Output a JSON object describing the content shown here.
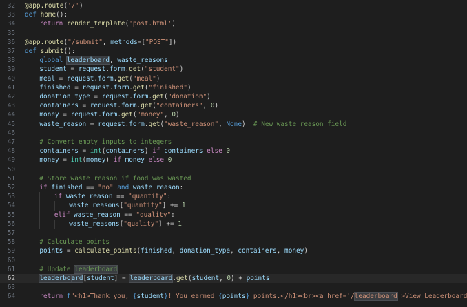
{
  "lines": [
    {
      "n": "32",
      "tokens": [
        [
          "t-fn",
          "@app.route"
        ],
        [
          "t-op",
          "("
        ],
        [
          "t-str",
          "'/'"
        ],
        [
          "t-op",
          ")"
        ]
      ]
    },
    {
      "n": "33",
      "tokens": [
        [
          "t-def",
          "def "
        ],
        [
          "t-fn",
          "home"
        ],
        [
          "t-op",
          "():"
        ]
      ]
    },
    {
      "n": "34",
      "indent": 1,
      "tokens": [
        [
          "t-kw",
          "return "
        ],
        [
          "t-fn",
          "render_template"
        ],
        [
          "t-op",
          "("
        ],
        [
          "t-str",
          "'post.html'"
        ],
        [
          "t-op",
          ")"
        ]
      ]
    },
    {
      "n": "35",
      "tokens": []
    },
    {
      "n": "36",
      "tokens": [
        [
          "t-fn",
          "@app.route"
        ],
        [
          "t-op",
          "("
        ],
        [
          "t-str",
          "\"/submit\""
        ],
        [
          "t-op",
          ", "
        ],
        [
          "t-var",
          "methods"
        ],
        [
          "t-op",
          "=["
        ],
        [
          "t-str",
          "\"POST\""
        ],
        [
          "t-op",
          "])"
        ]
      ]
    },
    {
      "n": "37",
      "tokens": [
        [
          "t-def",
          "def "
        ],
        [
          "t-fn",
          "submit"
        ],
        [
          "t-op",
          "():"
        ]
      ]
    },
    {
      "n": "38",
      "indent": 1,
      "tokens": [
        [
          "t-def",
          "global "
        ],
        [
          "hl t-var",
          "leaderboard"
        ],
        [
          "t-op",
          ", "
        ],
        [
          "t-var",
          "waste_reasons"
        ]
      ]
    },
    {
      "n": "39",
      "indent": 1,
      "tokens": [
        [
          "t-var",
          "student"
        ],
        [
          "t-op",
          " = "
        ],
        [
          "t-var",
          "request"
        ],
        [
          "t-op",
          "."
        ],
        [
          "t-var",
          "form"
        ],
        [
          "t-op",
          "."
        ],
        [
          "t-fn",
          "get"
        ],
        [
          "t-op",
          "("
        ],
        [
          "t-str",
          "\"student\""
        ],
        [
          "t-op",
          ")"
        ]
      ]
    },
    {
      "n": "40",
      "indent": 1,
      "tokens": [
        [
          "t-var",
          "meal"
        ],
        [
          "t-op",
          " = "
        ],
        [
          "t-var",
          "request"
        ],
        [
          "t-op",
          "."
        ],
        [
          "t-var",
          "form"
        ],
        [
          "t-op",
          "."
        ],
        [
          "t-fn",
          "get"
        ],
        [
          "t-op",
          "("
        ],
        [
          "t-str",
          "\"meal\""
        ],
        [
          "t-op",
          ")"
        ]
      ]
    },
    {
      "n": "41",
      "indent": 1,
      "tokens": [
        [
          "t-var",
          "finished"
        ],
        [
          "t-op",
          " = "
        ],
        [
          "t-var",
          "request"
        ],
        [
          "t-op",
          "."
        ],
        [
          "t-var",
          "form"
        ],
        [
          "t-op",
          "."
        ],
        [
          "t-fn",
          "get"
        ],
        [
          "t-op",
          "("
        ],
        [
          "t-str",
          "\"finished\""
        ],
        [
          "t-op",
          ")"
        ]
      ]
    },
    {
      "n": "42",
      "indent": 1,
      "tokens": [
        [
          "t-var",
          "donation_type"
        ],
        [
          "t-op",
          " = "
        ],
        [
          "t-var",
          "request"
        ],
        [
          "t-op",
          "."
        ],
        [
          "t-var",
          "form"
        ],
        [
          "t-op",
          "."
        ],
        [
          "t-fn",
          "get"
        ],
        [
          "t-op",
          "("
        ],
        [
          "t-str",
          "\"donation\""
        ],
        [
          "t-op",
          ")"
        ]
      ]
    },
    {
      "n": "43",
      "indent": 1,
      "tokens": [
        [
          "t-var",
          "containers"
        ],
        [
          "t-op",
          " = "
        ],
        [
          "t-var",
          "request"
        ],
        [
          "t-op",
          "."
        ],
        [
          "t-var",
          "form"
        ],
        [
          "t-op",
          "."
        ],
        [
          "t-fn",
          "get"
        ],
        [
          "t-op",
          "("
        ],
        [
          "t-str",
          "\"containers\""
        ],
        [
          "t-op",
          ", "
        ],
        [
          "t-num",
          "0"
        ],
        [
          "t-op",
          ")"
        ]
      ]
    },
    {
      "n": "44",
      "indent": 1,
      "tokens": [
        [
          "t-var",
          "money"
        ],
        [
          "t-op",
          " = "
        ],
        [
          "t-var",
          "request"
        ],
        [
          "t-op",
          "."
        ],
        [
          "t-var",
          "form"
        ],
        [
          "t-op",
          "."
        ],
        [
          "t-fn",
          "get"
        ],
        [
          "t-op",
          "("
        ],
        [
          "t-str",
          "\"money\""
        ],
        [
          "t-op",
          ", "
        ],
        [
          "t-num",
          "0"
        ],
        [
          "t-op",
          ")"
        ]
      ]
    },
    {
      "n": "45",
      "indent": 1,
      "tokens": [
        [
          "t-var",
          "waste_reason"
        ],
        [
          "t-op",
          " = "
        ],
        [
          "t-var",
          "request"
        ],
        [
          "t-op",
          "."
        ],
        [
          "t-var",
          "form"
        ],
        [
          "t-op",
          "."
        ],
        [
          "t-fn",
          "get"
        ],
        [
          "t-op",
          "("
        ],
        [
          "t-str",
          "\"waste_reason\""
        ],
        [
          "t-op",
          ", "
        ],
        [
          "t-const",
          "None"
        ],
        [
          "t-op",
          ")  "
        ],
        [
          "t-com",
          "# New waste reason field"
        ]
      ]
    },
    {
      "n": "46",
      "indent": 1,
      "tokens": []
    },
    {
      "n": "47",
      "indent": 1,
      "tokens": [
        [
          "t-com",
          "# Convert empty inputs to integers"
        ]
      ]
    },
    {
      "n": "48",
      "indent": 1,
      "tokens": [
        [
          "t-var",
          "containers"
        ],
        [
          "t-op",
          " = "
        ],
        [
          "t-builtin",
          "int"
        ],
        [
          "t-op",
          "("
        ],
        [
          "t-var",
          "containers"
        ],
        [
          "t-op",
          ") "
        ],
        [
          "t-kw",
          "if "
        ],
        [
          "t-var",
          "containers"
        ],
        [
          "t-kw",
          " else "
        ],
        [
          "t-num",
          "0"
        ]
      ]
    },
    {
      "n": "49",
      "indent": 1,
      "tokens": [
        [
          "t-var",
          "money"
        ],
        [
          "t-op",
          " = "
        ],
        [
          "t-builtin",
          "int"
        ],
        [
          "t-op",
          "("
        ],
        [
          "t-var",
          "money"
        ],
        [
          "t-op",
          ") "
        ],
        [
          "t-kw",
          "if "
        ],
        [
          "t-var",
          "money"
        ],
        [
          "t-kw",
          " else "
        ],
        [
          "t-num",
          "0"
        ]
      ]
    },
    {
      "n": "50",
      "indent": 1,
      "tokens": []
    },
    {
      "n": "51",
      "indent": 1,
      "tokens": [
        [
          "t-com",
          "# Store waste reason if food was wasted"
        ]
      ]
    },
    {
      "n": "52",
      "indent": 1,
      "tokens": [
        [
          "t-kw",
          "if "
        ],
        [
          "t-var",
          "finished"
        ],
        [
          "t-op",
          " == "
        ],
        [
          "t-str",
          "\"no\""
        ],
        [
          "t-def",
          " and "
        ],
        [
          "t-var",
          "waste_reason"
        ],
        [
          "t-op",
          ":"
        ]
      ]
    },
    {
      "n": "53",
      "indent": 2,
      "tokens": [
        [
          "t-kw",
          "if "
        ],
        [
          "t-var",
          "waste_reason"
        ],
        [
          "t-op",
          " == "
        ],
        [
          "t-str",
          "\"quantity\""
        ],
        [
          "t-op",
          ":"
        ]
      ]
    },
    {
      "n": "54",
      "indent": 3,
      "tokens": [
        [
          "t-var",
          "waste_reasons"
        ],
        [
          "t-op",
          "["
        ],
        [
          "t-str",
          "\"quantity\""
        ],
        [
          "t-op",
          "] += "
        ],
        [
          "t-num",
          "1"
        ]
      ]
    },
    {
      "n": "55",
      "indent": 2,
      "tokens": [
        [
          "t-kw",
          "elif "
        ],
        [
          "t-var",
          "waste_reason"
        ],
        [
          "t-op",
          " == "
        ],
        [
          "t-str",
          "\"quality\""
        ],
        [
          "t-op",
          ":"
        ]
      ]
    },
    {
      "n": "56",
      "indent": 3,
      "tokens": [
        [
          "t-var",
          "waste_reasons"
        ],
        [
          "t-op",
          "["
        ],
        [
          "t-str",
          "\"quality\""
        ],
        [
          "t-op",
          "] += "
        ],
        [
          "t-num",
          "1"
        ]
      ]
    },
    {
      "n": "57",
      "indent": 1,
      "tokens": []
    },
    {
      "n": "58",
      "indent": 1,
      "tokens": [
        [
          "t-com",
          "# Calculate points"
        ]
      ]
    },
    {
      "n": "59",
      "indent": 1,
      "tokens": [
        [
          "t-var",
          "points"
        ],
        [
          "t-op",
          " = "
        ],
        [
          "t-fn",
          "calculate_points"
        ],
        [
          "t-op",
          "("
        ],
        [
          "t-var",
          "finished"
        ],
        [
          "t-op",
          ", "
        ],
        [
          "t-var",
          "donation_type"
        ],
        [
          "t-op",
          ", "
        ],
        [
          "t-var",
          "containers"
        ],
        [
          "t-op",
          ", "
        ],
        [
          "t-var",
          "money"
        ],
        [
          "t-op",
          ")"
        ]
      ]
    },
    {
      "n": "60",
      "indent": 1,
      "tokens": []
    },
    {
      "n": "61",
      "indent": 1,
      "tokens": [
        [
          "t-com",
          "# Update "
        ],
        [
          "hl t-com",
          "leaderboard"
        ]
      ]
    },
    {
      "n": "62",
      "indent": 1,
      "current": true,
      "tokens": [
        [
          "hl t-var",
          "leaderbo"
        ],
        [
          "cursor",
          ""
        ],
        [
          "hl t-var",
          "ard"
        ],
        [
          "t-op",
          "["
        ],
        [
          "t-var",
          "student"
        ],
        [
          "t-op",
          "] = "
        ],
        [
          "hl t-var",
          "leaderboard"
        ],
        [
          "t-op",
          "."
        ],
        [
          "t-fn",
          "get"
        ],
        [
          "t-op",
          "("
        ],
        [
          "t-var",
          "student"
        ],
        [
          "t-op",
          ", "
        ],
        [
          "t-num",
          "0"
        ],
        [
          "t-op",
          ") + "
        ],
        [
          "t-var",
          "points"
        ]
      ]
    },
    {
      "n": "63",
      "indent": 1,
      "tokens": []
    },
    {
      "n": "64",
      "indent": 1,
      "tokens": [
        [
          "t-kw",
          "return "
        ],
        [
          "t-def",
          "f"
        ],
        [
          "t-str",
          "\"<h1>Thank you, "
        ],
        [
          "t-const",
          "{"
        ],
        [
          "t-var",
          "student"
        ],
        [
          "t-const",
          "}"
        ],
        [
          "t-str",
          "! You earned "
        ],
        [
          "t-const",
          "{"
        ],
        [
          "t-var",
          "points"
        ],
        [
          "t-const",
          "}"
        ],
        [
          "t-str",
          " points.</h1><br><a href='/"
        ],
        [
          "hl t-str",
          "leaderboard"
        ],
        [
          "t-str",
          "'>View Leaderboard</a>\""
        ]
      ]
    }
  ]
}
